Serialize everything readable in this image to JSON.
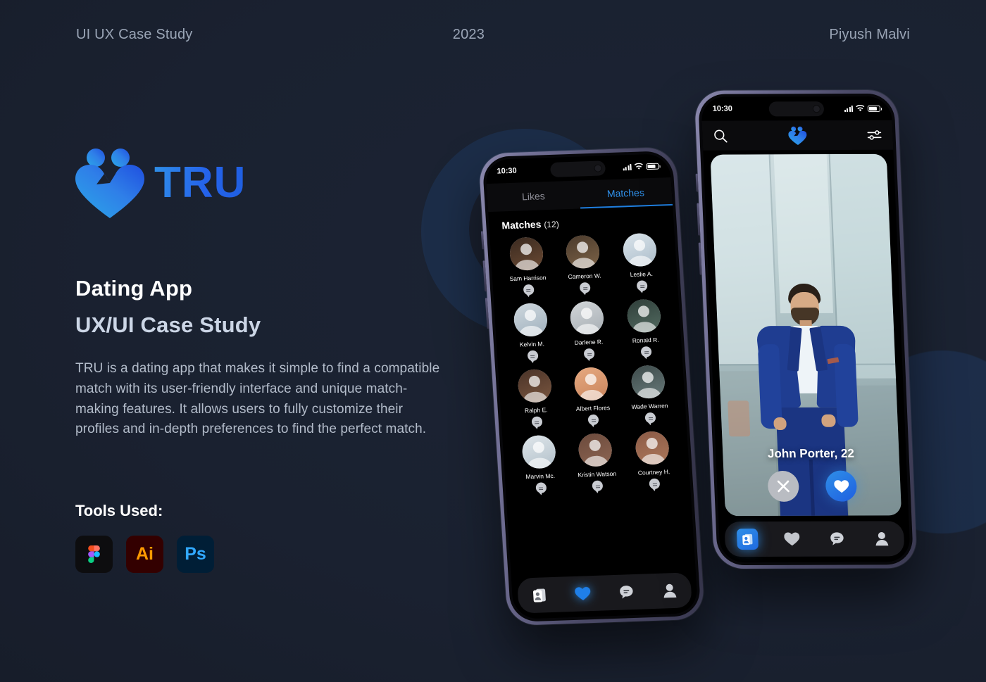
{
  "meta": {
    "left": "UI UX Case Study",
    "middle": "2023",
    "right": "Piyush Malvi"
  },
  "brand": {
    "name": "TRU",
    "logo_icon": "tru-heart-couple-icon"
  },
  "intro": {
    "title": "Dating App",
    "subtitle": "UX/UI Case Study",
    "description": "TRU is a dating app that makes it simple to find a compatible match with its user-friendly interface and unique match-making features. It allows users to fully customize their profiles and in-depth preferences to find the perfect match."
  },
  "tools": {
    "label": "Tools Used:",
    "items": [
      {
        "name": "Figma",
        "short": "",
        "icon": "figma-icon",
        "bg": "#0d0d0f"
      },
      {
        "name": "Adobe Illustrator",
        "short": "Ai",
        "icon": "illustrator-icon",
        "bg": "#330000",
        "fg": "#ff9a00"
      },
      {
        "name": "Adobe Photoshop",
        "short": "Ps",
        "icon": "photoshop-icon",
        "bg": "#001e36",
        "fg": "#31a8ff"
      }
    ]
  },
  "colors": {
    "background": "#1a2130",
    "accent_blue": "#2f8fe8",
    "accent_blue_deep": "#1f5fe0",
    "deco_circle": "#1d3150",
    "heading": "#ffffff",
    "subheading": "#ccd6e6",
    "body_text": "#b3bcca",
    "meta_text": "#9aa5b6",
    "phone_frame": "#6f6d92"
  },
  "phone_left": {
    "status": {
      "time": "10:30",
      "signal_icon": "signal-bars-icon",
      "wifi_icon": "wifi-icon",
      "battery_icon": "battery-icon"
    },
    "tabs": [
      {
        "label": "Likes",
        "active": false
      },
      {
        "label": "Matches",
        "active": true
      }
    ],
    "section_title": "Matches",
    "section_count": "(12)",
    "matches": [
      {
        "name": "Sam Harrison"
      },
      {
        "name": "Cameron W."
      },
      {
        "name": "Leslie A."
      },
      {
        "name": "Kelvin M."
      },
      {
        "name": "Darlene R."
      },
      {
        "name": "Ronald R."
      },
      {
        "name": "Ralph E."
      },
      {
        "name": "Albert Flores"
      },
      {
        "name": "Wade Warren"
      },
      {
        "name": "Marvin Mc."
      },
      {
        "name": "Kristin Watson"
      },
      {
        "name": "Courtney H."
      }
    ],
    "nav": [
      {
        "icon": "cards-stack-icon",
        "active": false
      },
      {
        "icon": "heart-icon",
        "active": true
      },
      {
        "icon": "chat-bubble-icon",
        "active": false
      },
      {
        "icon": "profile-person-icon",
        "active": false
      }
    ]
  },
  "phone_right": {
    "status": {
      "time": "10:30",
      "signal_icon": "signal-bars-icon",
      "wifi_icon": "wifi-icon",
      "battery_icon": "battery-icon"
    },
    "appbar": {
      "search_icon": "search-icon",
      "logo_icon": "tru-heart-couple-icon",
      "filter_icon": "filter-sliders-icon"
    },
    "profile": {
      "name_age": "John Porter, 22",
      "photo_alt": "man-in-blue-suit-photo"
    },
    "actions": [
      {
        "icon": "close-x-icon",
        "label": "pass"
      },
      {
        "icon": "heart-icon",
        "label": "like"
      }
    ],
    "nav": [
      {
        "icon": "cards-stack-icon",
        "active": true
      },
      {
        "icon": "heart-icon",
        "active": false
      },
      {
        "icon": "chat-bubble-icon",
        "active": false
      },
      {
        "icon": "profile-person-icon",
        "active": false
      }
    ]
  }
}
